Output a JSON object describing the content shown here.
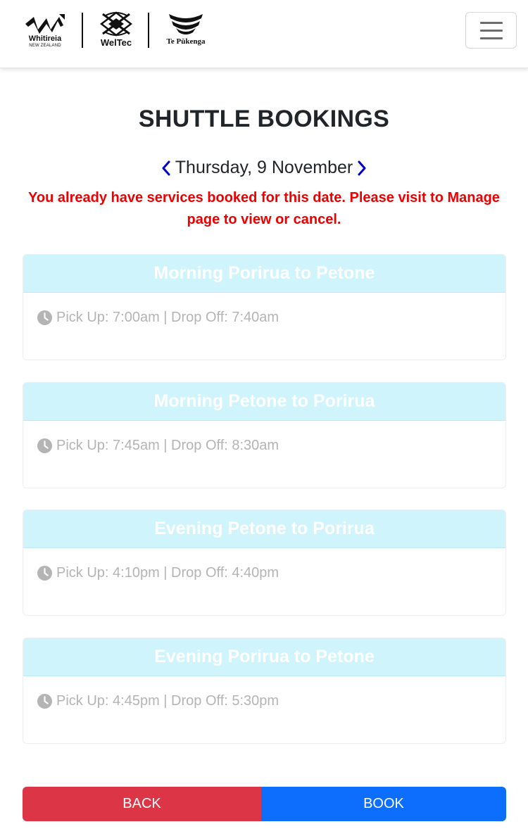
{
  "header": {
    "logos": [
      {
        "name": "Whitireia",
        "sub": "NEW ZEALAND"
      },
      {
        "name": "WelTec"
      },
      {
        "name": "Te Pūkenga"
      }
    ],
    "menu_icon": "hamburger-icon"
  },
  "page": {
    "title": "SHUTTLE BOOKINGS",
    "date": "Thursday, 9 November",
    "prev_icon": "chevron-left-icon",
    "next_icon": "chevron-right-icon",
    "warning": "You already have services booked for this date. Please visit to Manage page to view or cancel."
  },
  "services": [
    {
      "title": "Morning Porirua to Petone",
      "times": "Pick Up: 7:00am | Drop Off: 7:40am"
    },
    {
      "title": "Morning Petone to Porirua",
      "times": "Pick Up: 7:45am | Drop Off: 8:30am"
    },
    {
      "title": "Evening Petone to Porirua",
      "times": "Pick Up: 4:10pm | Drop Off: 4:40pm"
    },
    {
      "title": "Evening Porirua to Petone",
      "times": "Pick Up: 4:45pm | Drop Off: 5:30pm"
    }
  ],
  "actions": {
    "back_label": "BACK",
    "book_label": "BOOK"
  },
  "colors": {
    "card_header": "#cff4fc",
    "warning": "#ee0000",
    "back": "#dc3545",
    "book": "#0d6efd",
    "chevron": "#0000cc"
  }
}
